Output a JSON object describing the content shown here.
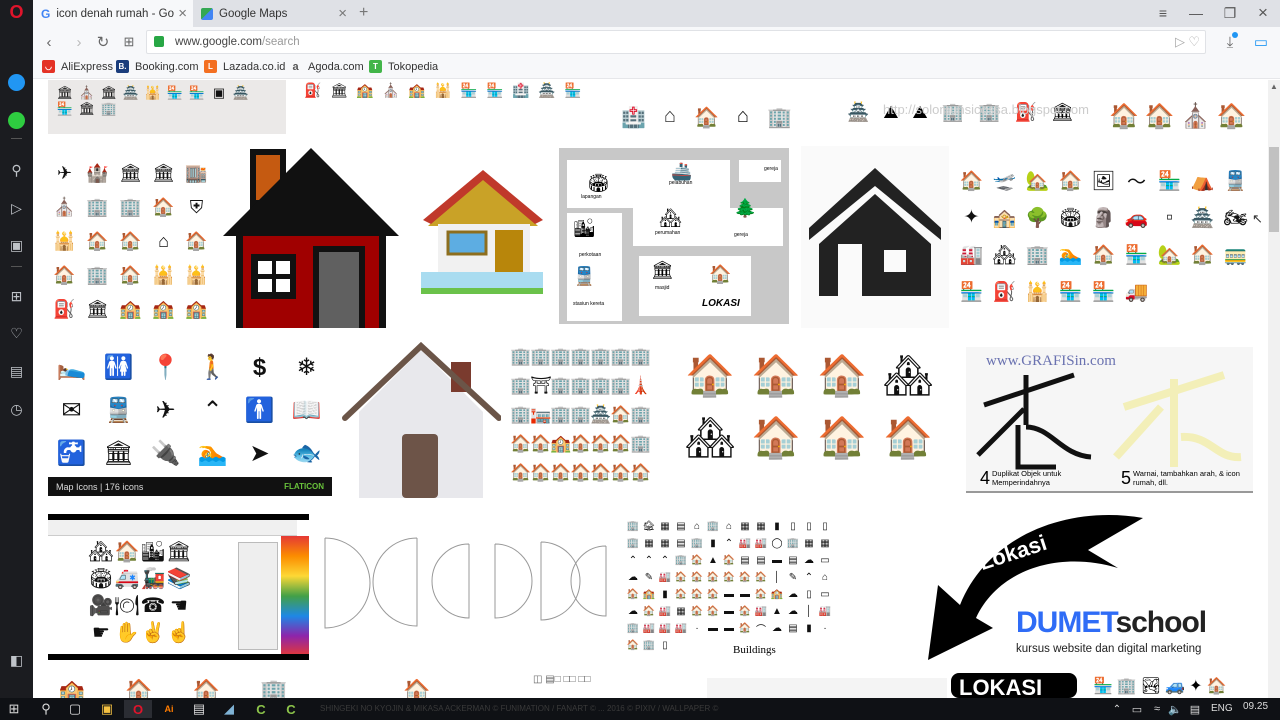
{
  "browser": {
    "tabs": [
      {
        "title": "icon denah rumah - Google",
        "icon": "google-g-icon",
        "active": true
      },
      {
        "title": "Google Maps",
        "icon": "google-maps-icon",
        "active": false
      }
    ],
    "new_tab": "+",
    "url_host": "www.google.com",
    "url_path": "/search",
    "bookmarks": [
      {
        "label": "AliExpress",
        "color": "#e43225",
        "glyph": "◡"
      },
      {
        "label": "Booking.com",
        "color": "#1a3d7c",
        "glyph": "B."
      },
      {
        "label": "Lazada.co.id",
        "color": "#f36f21",
        "glyph": "L"
      },
      {
        "label": "Agoda.com",
        "color": "#ffffff",
        "glyph": "a"
      },
      {
        "label": "Tokopedia",
        "color": "#42b549",
        "glyph": "T"
      }
    ]
  },
  "sidebar": {
    "items": [
      "messenger-icon",
      "whatsapp-icon",
      "search-icon",
      "send-icon",
      "camera-icon",
      "speed-dial-icon",
      "heart-icon",
      "news-icon",
      "history-icon"
    ]
  },
  "results": {
    "flaticon_caption": "Map Icons | 176 icons",
    "flaticon_brand": "FLATICON",
    "grafisin_title": "www.GRAFISin.com",
    "grafisin_step4_num": "4",
    "grafisin_step4": "Duplikat Objek untuk Memperindahnya",
    "grafisin_step5_num": "5",
    "grafisin_step5": "Warnai, tambahkan arah, & icon rumah, dll.",
    "map_lokasi": "LOKASI",
    "map_labels": [
      "lapangan",
      "pelabuhan",
      "gereja",
      "perumahan",
      "gereja",
      "perkotaan",
      "masjid",
      "stasiun kereta"
    ],
    "buildings_caption": "Buildings",
    "dumet_arrow_text": "Lokasi",
    "dumet_brand_a": "DUMET",
    "dumet_brand_b": "school",
    "dumet_tagline": "kursus website dan digital marketing",
    "bottom_lokasi": "LOKASI",
    "watermark": "http://solomunsicossa.blogspot.com"
  },
  "taskbar": {
    "language": "ENG",
    "time": "09.25",
    "overlay_text": "SHINGEKI NO KYOJIN & MIKASA ACKERMAN © FUNIMATION / FANART © ... 2016 © PIXIV / WALLPAPER ©"
  },
  "colors": {
    "accent_blue": "#2f6cf6",
    "lock_green": "#28a745",
    "opera_red": "#e0142b",
    "flaticon_green": "#69c33b"
  }
}
